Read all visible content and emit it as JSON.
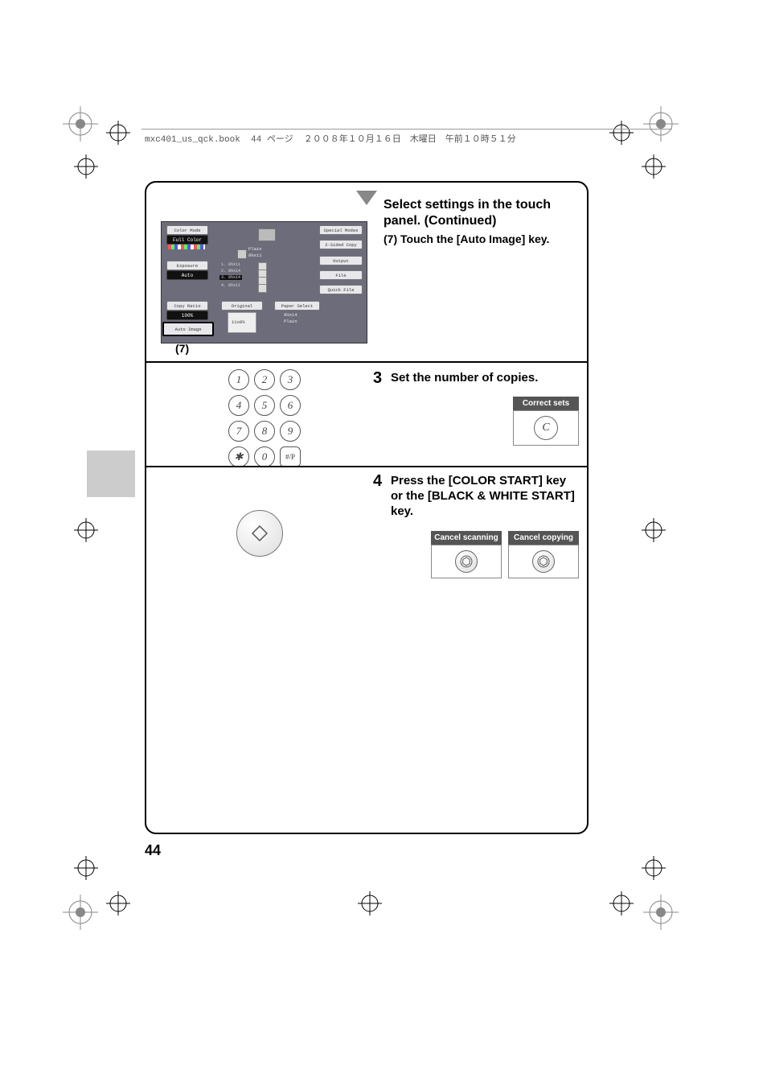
{
  "print_header": "mxc401_us_qck.book  44 ページ  ２００８年１０月１６日　木曜日　午前１０時５１分",
  "page_number": "44",
  "section": {
    "title": "Select settings in the touch panel. (Continued)",
    "substep_num": "(7)",
    "substep_text": "Touch the [Auto Image] key.",
    "callout_label": "(7)"
  },
  "step3": {
    "number": "3",
    "text": "Set the number of copies.",
    "correct_sets_label": "Correct sets",
    "c_key": "C"
  },
  "step4": {
    "number": "4",
    "text": "Press the [COLOR START] key or the [BLACK & WHITE START] key.",
    "cancel_scanning": "Cancel scanning",
    "cancel_copying": "Cancel copying"
  },
  "keypad": {
    "keys": [
      "1",
      "2",
      "3",
      "4",
      "5",
      "6",
      "7",
      "8",
      "9",
      "✱",
      "0",
      "#/P"
    ]
  },
  "touch_panel": {
    "color_mode_label": "Color Mode",
    "color_mode_value": "Full Color",
    "exposure_label": "Exposure",
    "exposure_value": "Auto",
    "copy_ratio_label": "Copy Ratio",
    "copy_ratio_value": "100%",
    "auto_image": "Auto Image",
    "original_label": "Original",
    "original_value": "11x8½",
    "paper_select_label": "Paper Select",
    "paper_select_value": "8½x14",
    "paper_select_sub": "Plain",
    "plain_label": "Plain",
    "plain_size": "8½x11",
    "trays": {
      "1": "1.  8½x11",
      "2": "2.  8½x14",
      "3": "3.  8½x14",
      "4": "4.  8½x11"
    },
    "right_buttons": {
      "special_modes": "Special Modes",
      "two_sided": "2-Sided Copy",
      "output": "Output",
      "file": "File",
      "quick_file": "Quick File"
    }
  }
}
